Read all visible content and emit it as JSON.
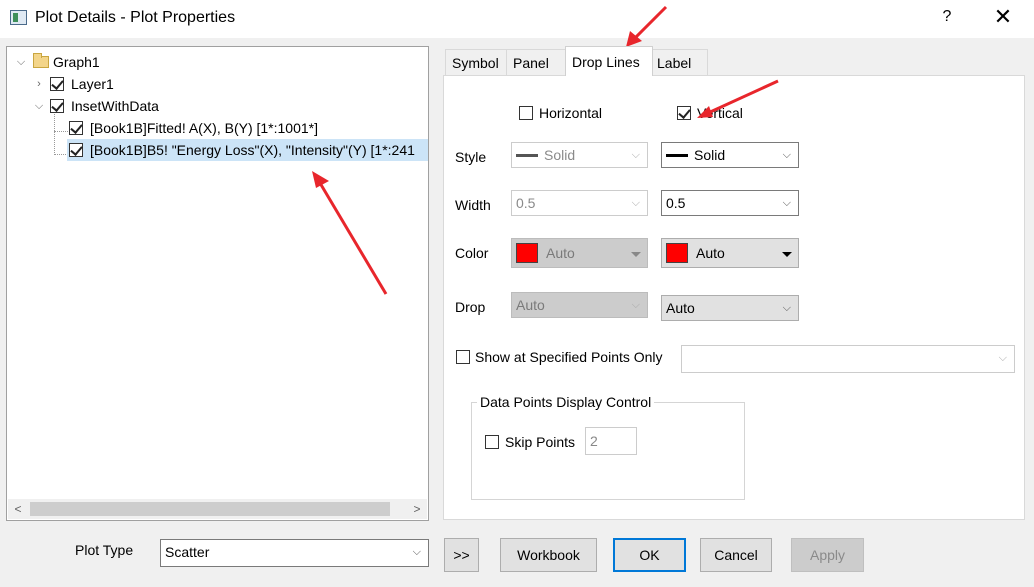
{
  "window": {
    "title": "Plot Details - Plot Properties",
    "help": "?",
    "close": "✕"
  },
  "tree": {
    "root": "Graph1",
    "layer": "Layer1",
    "inset": "InsetWithData",
    "plot1": "[Book1B]Fitted! A(X), B(Y) [1*:1001*]",
    "plot2": "[Book1B]B5! \"Energy Loss\"(X), \"Intensity\"(Y) [1*:241"
  },
  "tabs": [
    "Symbol",
    "Panel",
    "Drop Lines",
    "Label"
  ],
  "active_tab": "Drop Lines",
  "droplines": {
    "horizontal_label": "Horizontal",
    "horizontal_checked": false,
    "vertical_label": "Vertical",
    "vertical_checked": true,
    "style_label": "Style",
    "width_label": "Width",
    "color_label": "Color",
    "drop_label": "Drop",
    "h_style": "Solid",
    "v_style": "Solid",
    "h_width": "0.5",
    "v_width": "0.5",
    "h_color": "Auto",
    "v_color": "Auto",
    "h_drop": "Auto",
    "v_drop": "Auto",
    "swatch_color": "#ff0000",
    "show_specified_label": "Show at Specified Points Only",
    "show_specified_value": "",
    "group_title": "Data Points Display Control",
    "skip_label": "Skip Points",
    "skip_value": "2"
  },
  "footer": {
    "plot_type_label": "Plot Type",
    "plot_type_value": "Scatter",
    "expand": ">>",
    "workbook": "Workbook",
    "ok": "OK",
    "cancel": "Cancel",
    "apply": "Apply"
  },
  "annotation_color": "#e8262c"
}
